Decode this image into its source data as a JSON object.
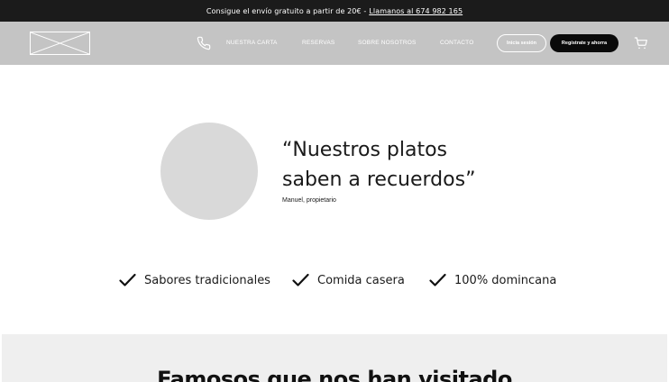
{
  "promo": {
    "text": "Consigue el envío gratuito a partir de 20€ -",
    "link_label": "Llamanos al 674 982 165"
  },
  "nav": {
    "links": [
      "NUESTRA CARTA",
      "RESERVAS",
      "SOBRE NOSOTROS",
      "CONTACTO"
    ],
    "login_label": "Inicia sesión",
    "register_label": "Regístrate y ahorra"
  },
  "hero": {
    "quote_line1": "“Nuestros platos",
    "quote_line2": "saben a recuerdos”",
    "author": "Manuel, propietario"
  },
  "features": [
    "Sabores tradicionales",
    "Comida casera",
    "100% domincana"
  ],
  "famous": {
    "title": "Famosos que nos han visitado"
  },
  "icons": [
    "phone-icon",
    "cart-icon",
    "check-icon"
  ],
  "colors": {
    "promo_bg": "#1b1b1b",
    "navbar_bg": "#c4c4c4",
    "placeholder": "#d9d9d9",
    "section_bg": "#efefef",
    "button_dark": "#0a0a0a"
  }
}
